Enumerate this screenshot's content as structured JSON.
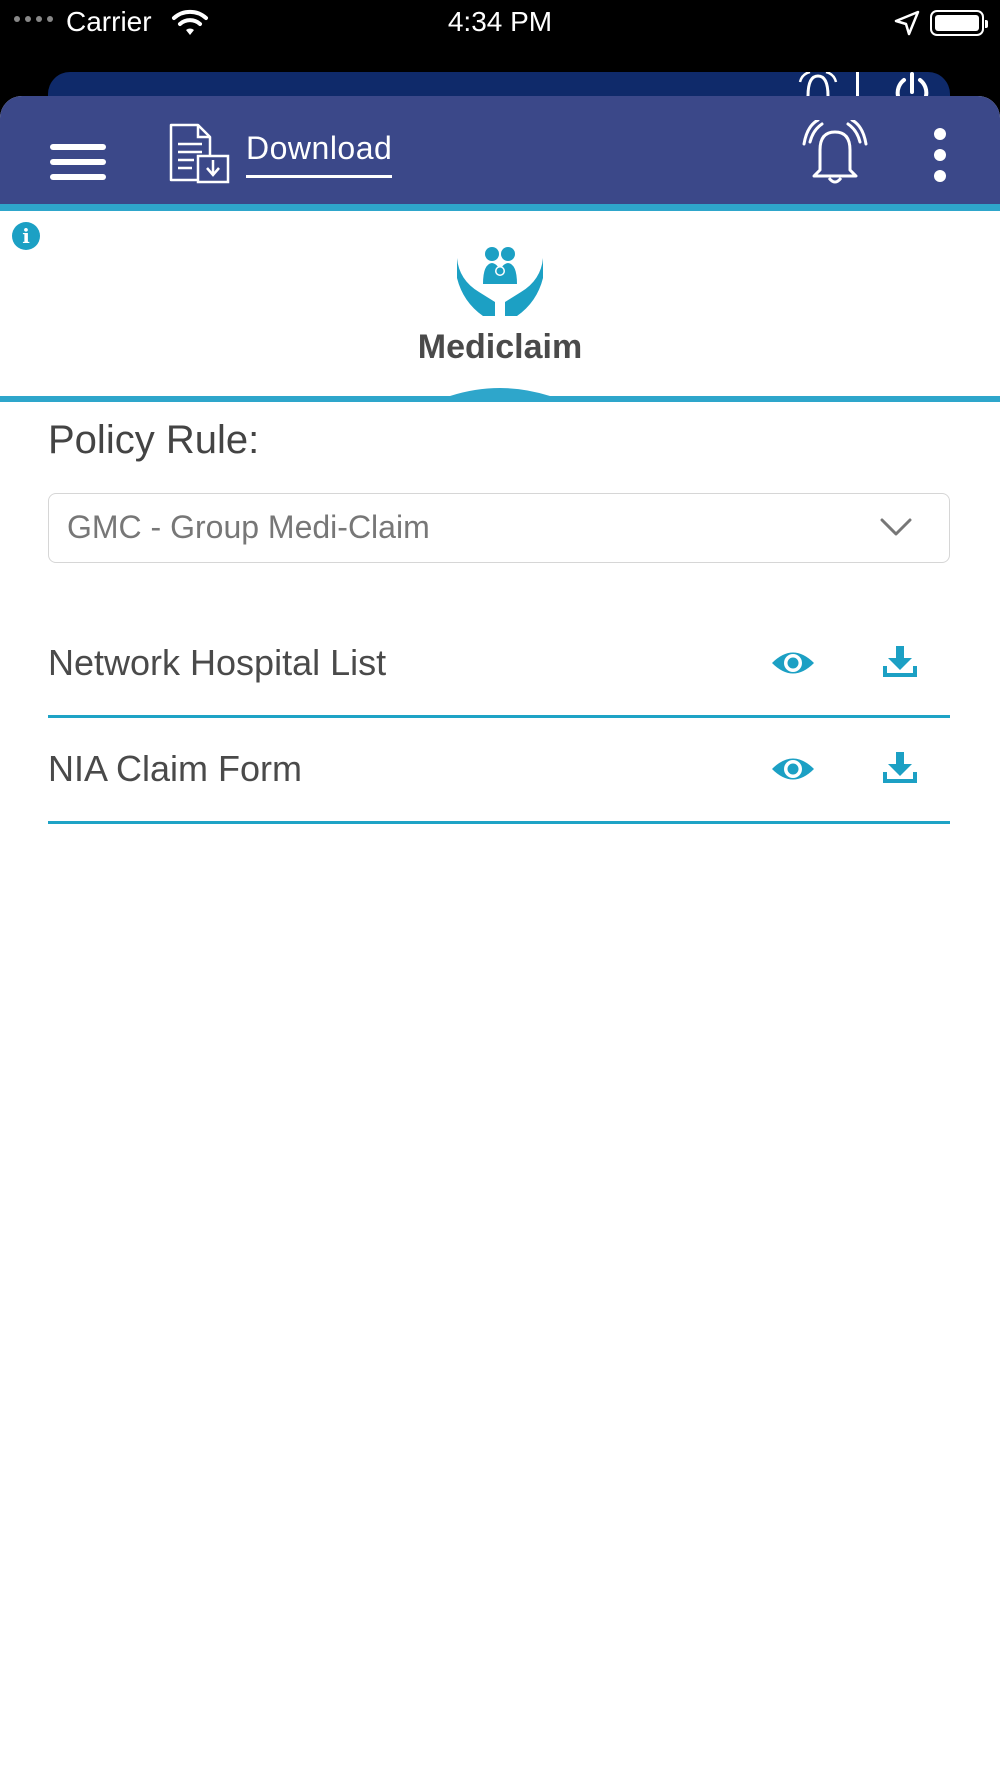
{
  "status_bar": {
    "carrier": "Carrier",
    "time": "4:34 PM"
  },
  "header": {
    "title": "Download",
    "menu_icon": "hamburger-menu-icon",
    "page_icon": "document-download-icon",
    "alert_icon": "alarm-bell-icon",
    "more_icon": "more-vertical-icon"
  },
  "category_tab": {
    "label": "Mediclaim",
    "icon": "family-care-hands-icon",
    "info_icon": "info-icon"
  },
  "policy": {
    "label": "Policy Rule:",
    "selected": "GMC - Group Medi-Claim"
  },
  "documents": [
    {
      "name": "Network Hospital List",
      "view_icon": "eye-icon",
      "download_icon": "download-icon"
    },
    {
      "name": "NIA Claim Form",
      "view_icon": "eye-icon",
      "download_icon": "download-icon"
    }
  ],
  "colors": {
    "appbar": "#3b4889",
    "accent": "#2ea6cb",
    "icon_teal": "#1ca0c4",
    "text": "#4a4a4a"
  }
}
